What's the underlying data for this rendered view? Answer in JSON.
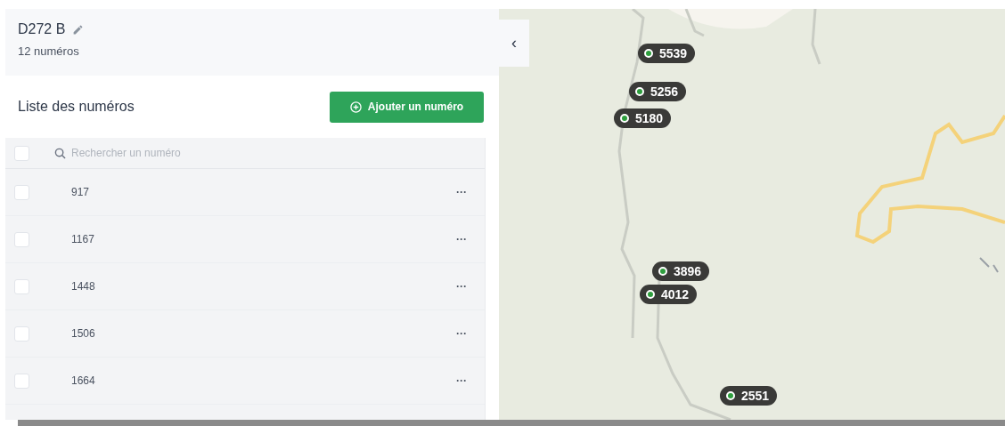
{
  "route": {
    "title": "D272 B",
    "subtitle": "12 numéros"
  },
  "list": {
    "title": "Liste des numéros",
    "add_button": "Ajouter un numéro",
    "search": {
      "placeholder": "Rechercher un numéro"
    },
    "select_all": {
      "checked": false
    },
    "rows": [
      {
        "number": "917",
        "checked": false,
        "menu": "···"
      },
      {
        "number": "1167",
        "checked": false,
        "menu": "···"
      },
      {
        "number": "1448",
        "checked": false,
        "menu": "···"
      },
      {
        "number": "1506",
        "checked": false,
        "menu": "···"
      },
      {
        "number": "1664",
        "checked": false,
        "menu": "···"
      }
    ]
  },
  "map": {
    "collapse_button": "‹",
    "markers": [
      {
        "label": "5539",
        "color": "#2e9e3e"
      },
      {
        "label": "5256",
        "color": "#2e9e3e"
      },
      {
        "label": "5180",
        "color": "#2e9e3e"
      },
      {
        "label": "3896",
        "color": "#2e9e3e"
      },
      {
        "label": "4012",
        "color": "#2e9e3e"
      },
      {
        "label": "2551",
        "color": "#2e9e3e"
      }
    ]
  }
}
